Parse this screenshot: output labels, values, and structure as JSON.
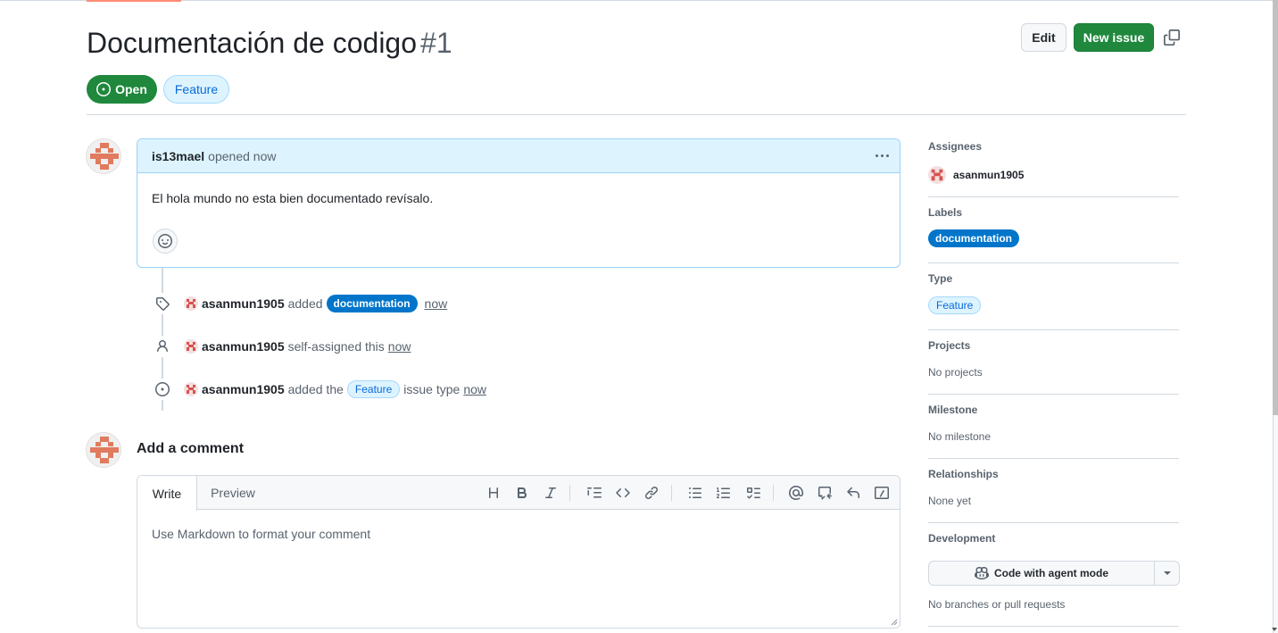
{
  "issue": {
    "title": "Documentación de codigo",
    "number": "#1",
    "state": "Open",
    "type": "Feature"
  },
  "header_actions": {
    "edit_label": "Edit",
    "new_issue_label": "New issue"
  },
  "comment": {
    "author": "is13mael",
    "meta": "opened now",
    "body": "El hola mundo no esta bien documentado revísalo."
  },
  "timeline": [
    {
      "actor": "asanmun1905",
      "action": "added",
      "label": "documentation",
      "time": "now"
    },
    {
      "actor": "asanmun1905",
      "action": "self-assigned this",
      "time": "now"
    },
    {
      "actor": "asanmun1905",
      "action": "added the",
      "label": "Feature",
      "suffix": "issue type",
      "time": "now"
    }
  ],
  "composer": {
    "title": "Add a comment",
    "tab_write": "Write",
    "tab_preview": "Preview",
    "placeholder": "Use Markdown to format your comment"
  },
  "sidebar": {
    "assignees_title": "Assignees",
    "assignee": "asanmun1905",
    "labels_title": "Labels",
    "label": "documentation",
    "type_title": "Type",
    "type_value": "Feature",
    "projects_title": "Projects",
    "projects_value": "No projects",
    "milestone_title": "Milestone",
    "milestone_value": "No milestone",
    "relationships_title": "Relationships",
    "relationships_value": "None yet",
    "development_title": "Development",
    "agent_button": "Code with agent mode",
    "development_value": "No branches or pull requests"
  },
  "colors": {
    "primary_green": "#1f883d",
    "label_documentation": "#0075ca",
    "feature_bg": "#ddf4ff",
    "accent_blue": "#0969da"
  }
}
